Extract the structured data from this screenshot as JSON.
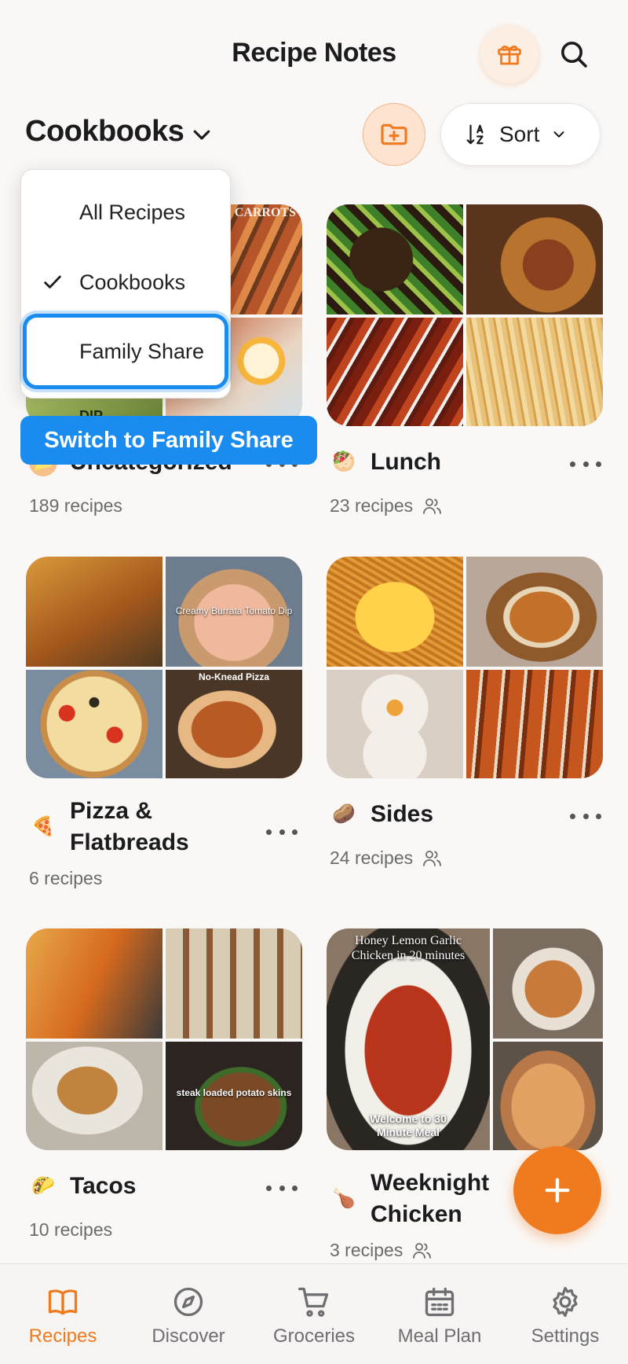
{
  "header": {
    "title": "Recipe Notes",
    "view_label": "Cookbooks",
    "sort_label": "Sort"
  },
  "icons": {
    "gift": "gift-icon",
    "search": "search-icon",
    "chevron": "chevron-down-icon",
    "folder_add": "folder-add-icon",
    "sort": "sort-az-icon",
    "more": "more-dots-icon",
    "shared": "people-icon",
    "add": "plus-icon",
    "check": "checkmark-icon"
  },
  "colors": {
    "accent": "#f07a1e",
    "focus_blue": "#1a8cf0",
    "background": "#faf8f6"
  },
  "view_menu": {
    "items": [
      {
        "label": "All Recipes",
        "selected": false
      },
      {
        "label": "Cookbooks",
        "selected": true
      },
      {
        "label": "Family Share",
        "selected": false,
        "focused": true
      }
    ],
    "tooltip": "Switch to Family Share"
  },
  "cookbooks": [
    {
      "name": "Uncategorized",
      "emoji": "📁",
      "count": "189 recipes",
      "shared": false
    },
    {
      "name": "Lunch",
      "emoji": "🥙",
      "count": "23 recipes",
      "shared": true
    },
    {
      "name": "Pizza & Flatbreads",
      "emoji": "🍕",
      "count": "6 recipes",
      "shared": false
    },
    {
      "name": "Sides",
      "emoji": "🥔",
      "count": "24 recipes",
      "shared": true
    },
    {
      "name": "Tacos",
      "emoji": "🌮",
      "count": "10 recipes",
      "shared": false
    },
    {
      "name": "Weeknight Chicken",
      "emoji": "🍗",
      "count": "3 recipes",
      "shared": true
    }
  ],
  "image_captions": {
    "carrots": "CARROTS",
    "dip": "DIP",
    "burrata": "Creamy Burrata Tomato Dip",
    "pizza": "No-Knead Pizza",
    "potato": "steak loaded potato skins",
    "chicken_top": "Honey Lemon Garlic Chicken in 20 minutes",
    "chicken_bottom": "Welcome to 30 Minute Meal"
  },
  "tabs": [
    {
      "label": "Recipes",
      "icon": "book-icon",
      "active": true
    },
    {
      "label": "Discover",
      "icon": "compass-icon",
      "active": false
    },
    {
      "label": "Groceries",
      "icon": "cart-icon",
      "active": false
    },
    {
      "label": "Meal Plan",
      "icon": "calendar-icon",
      "active": false
    },
    {
      "label": "Settings",
      "icon": "gear-icon",
      "active": false
    }
  ]
}
